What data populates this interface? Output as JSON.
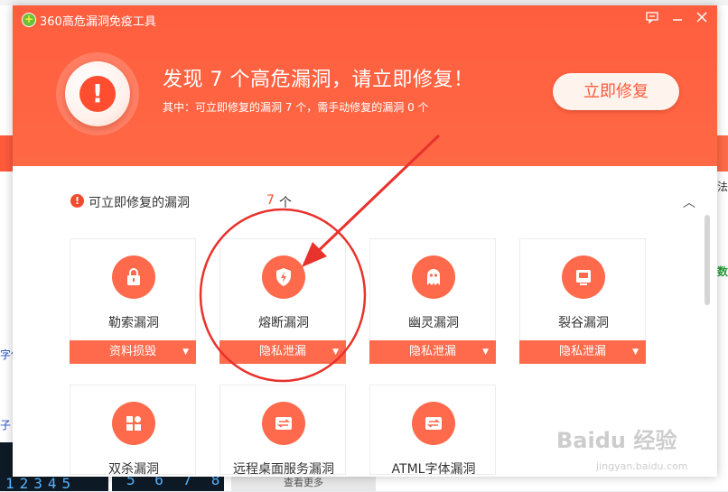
{
  "window": {
    "title": "360高危漏洞免疫工具",
    "logo_glyph": "+"
  },
  "header": {
    "headline": "发现 7 个高危漏洞，请立即修复！",
    "subline": "其中：可立即修复的漏洞 7 个，需手动修复的漏洞 0 个",
    "repair_button": "立即修复",
    "alert_glyph": "!"
  },
  "section": {
    "title": "可立即修复的漏洞",
    "count": "7",
    "unit": "个",
    "collapse_glyph": "︿"
  },
  "cards": [
    {
      "name": "勒索漏洞",
      "tag": "资料损毁",
      "icon": "lock-icon"
    },
    {
      "name": "熔断漏洞",
      "tag": "隐私泄漏",
      "icon": "lightning-shield-icon"
    },
    {
      "name": "幽灵漏洞",
      "tag": "隐私泄漏",
      "icon": "ghost-icon"
    },
    {
      "name": "裂谷漏洞",
      "tag": "隐私泄漏",
      "icon": "monitor-icon"
    },
    {
      "name": "双杀漏洞",
      "icon": "app-grid-icon"
    },
    {
      "name": "远程桌面服务漏洞",
      "icon": "transfer-arrows-icon"
    },
    {
      "name": "ATML字体漏洞",
      "icon": "transfer-arrows-icon"
    }
  ],
  "background": {
    "frag_far": "法",
    "frag_digits1": "12345",
    "frag_digits2": "5 6 7 8",
    "frag_more": "查看更多",
    "frag_blue": "字体",
    "frag_green": "数",
    "frag_zi": "子"
  },
  "watermark": {
    "brand": "Baidu 经验",
    "url": "jingyan.baidu.com"
  },
  "colors": {
    "header_orange": "#ff5e3e",
    "accent": "#fe6a4b",
    "annotation_red": "#e8322c"
  }
}
